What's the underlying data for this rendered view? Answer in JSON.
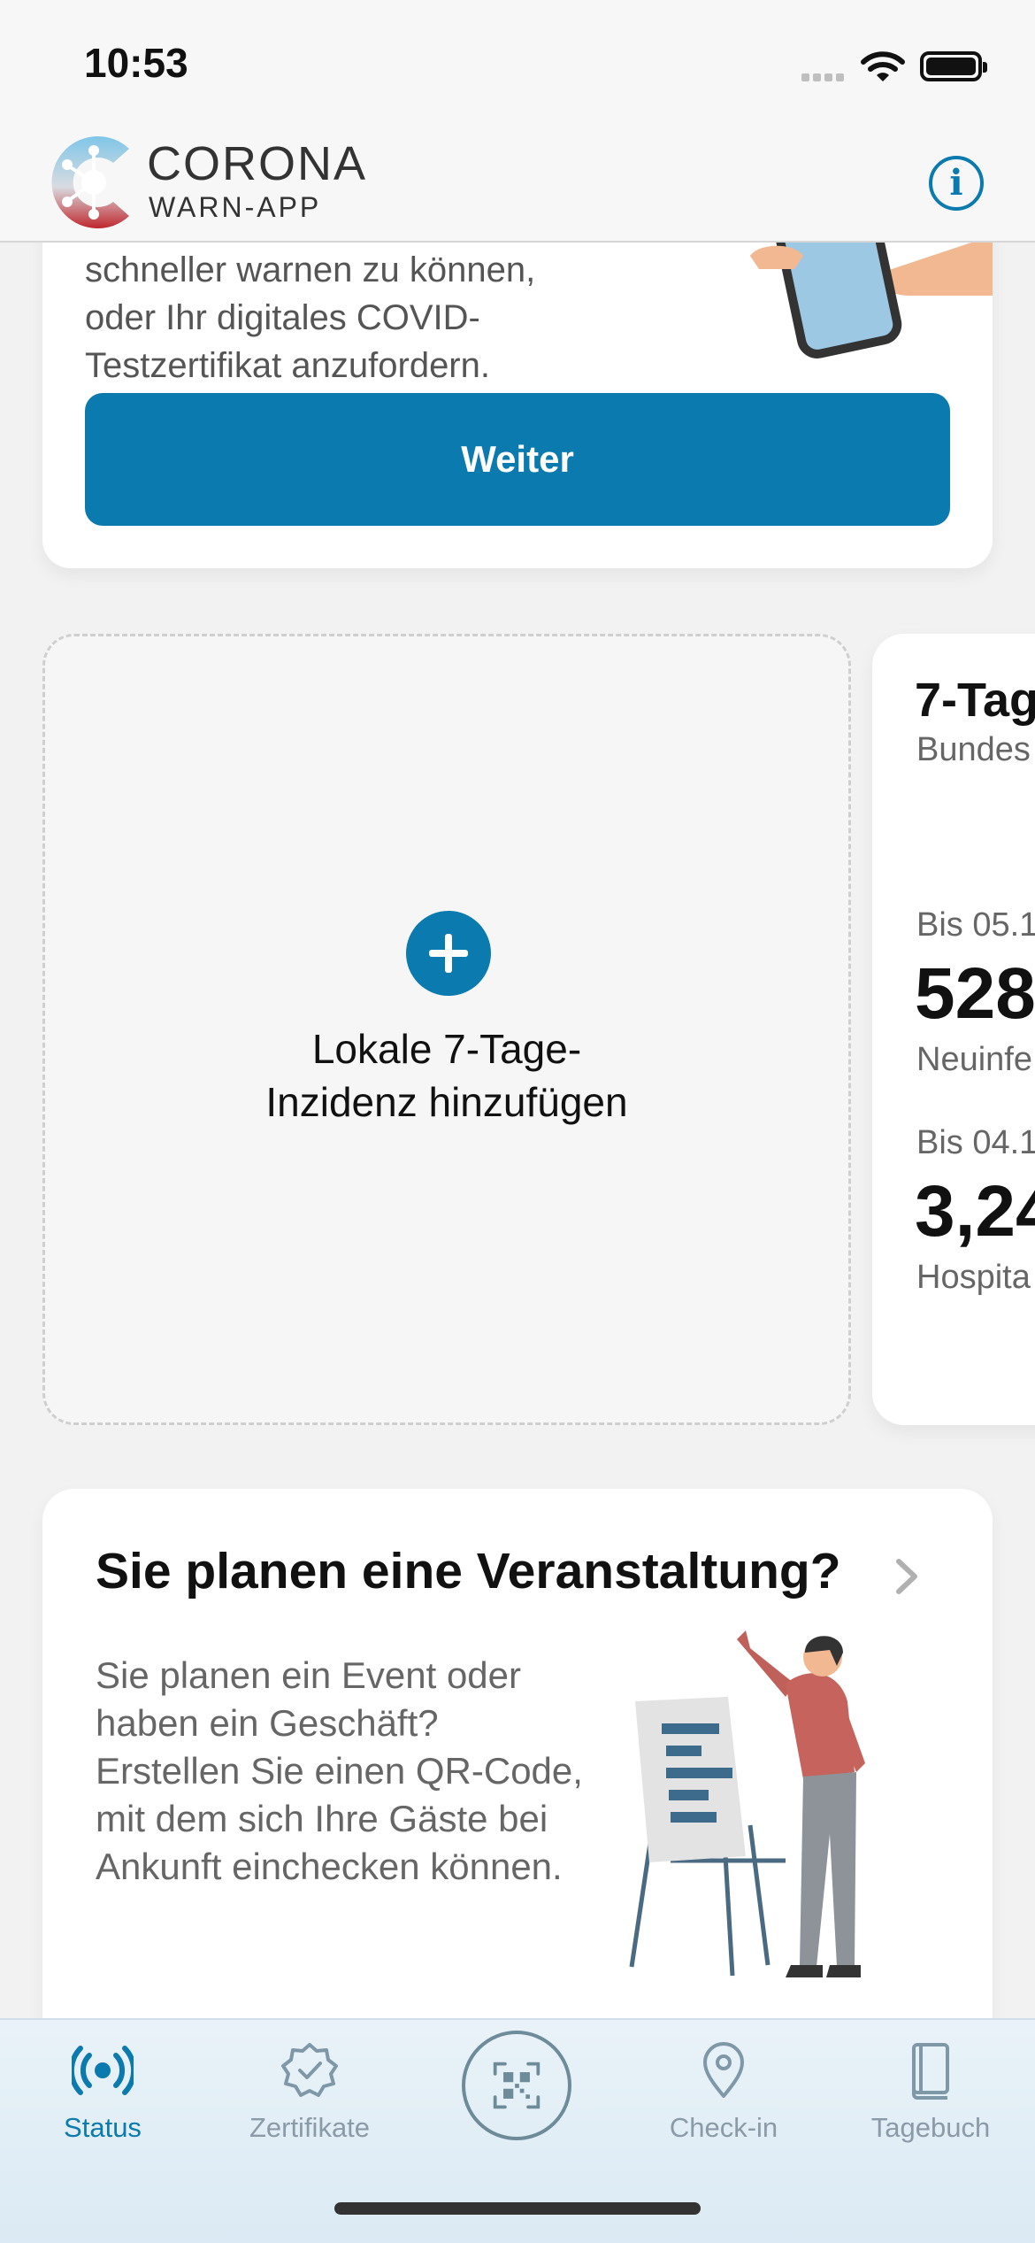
{
  "status_bar": {
    "time": "10:53"
  },
  "header": {
    "app_title": "CORONA",
    "app_subtitle": "WARN-APP",
    "info_icon": "info-icon"
  },
  "intro_card": {
    "text": "schneller warnen zu können, oder Ihr digitales COVID-Testzertifikat anzufordern.",
    "button_label": "Weiter"
  },
  "add_incidence_card": {
    "label": "Lokale 7-Tage-\nInzidenz hinzufügen",
    "icon": "plus-icon"
  },
  "stats_card": {
    "title": "7-Tag",
    "subtitle": "Bundes",
    "items": [
      {
        "label": "Bis 05.1",
        "value": "528",
        "caption": "Neuinfe"
      },
      {
        "label": "Bis 04.1",
        "value": "3,24",
        "caption": "Hospita"
      }
    ]
  },
  "event_card": {
    "title": "Sie planen eine Veranstaltung?",
    "text": "Sie planen ein Event oder haben ein Geschäft? Erstellen Sie einen QR-Code, mit dem sich Ihre Gäste bei Ankunft einchecken können."
  },
  "tab_bar": {
    "tabs": [
      {
        "label": "Status",
        "icon": "status-icon",
        "active": true
      },
      {
        "label": "Zertifikate",
        "icon": "certificate-icon",
        "active": false
      },
      {
        "label": "",
        "icon": "qr-scan-icon",
        "active": false
      },
      {
        "label": "Check-in",
        "icon": "location-pin-icon",
        "active": false
      },
      {
        "label": "Tagebuch",
        "icon": "diary-icon",
        "active": false
      }
    ]
  },
  "colors": {
    "accent": "#0b7aae",
    "tab_inactive": "#8a9aa6",
    "background": "#f2f2f2"
  }
}
